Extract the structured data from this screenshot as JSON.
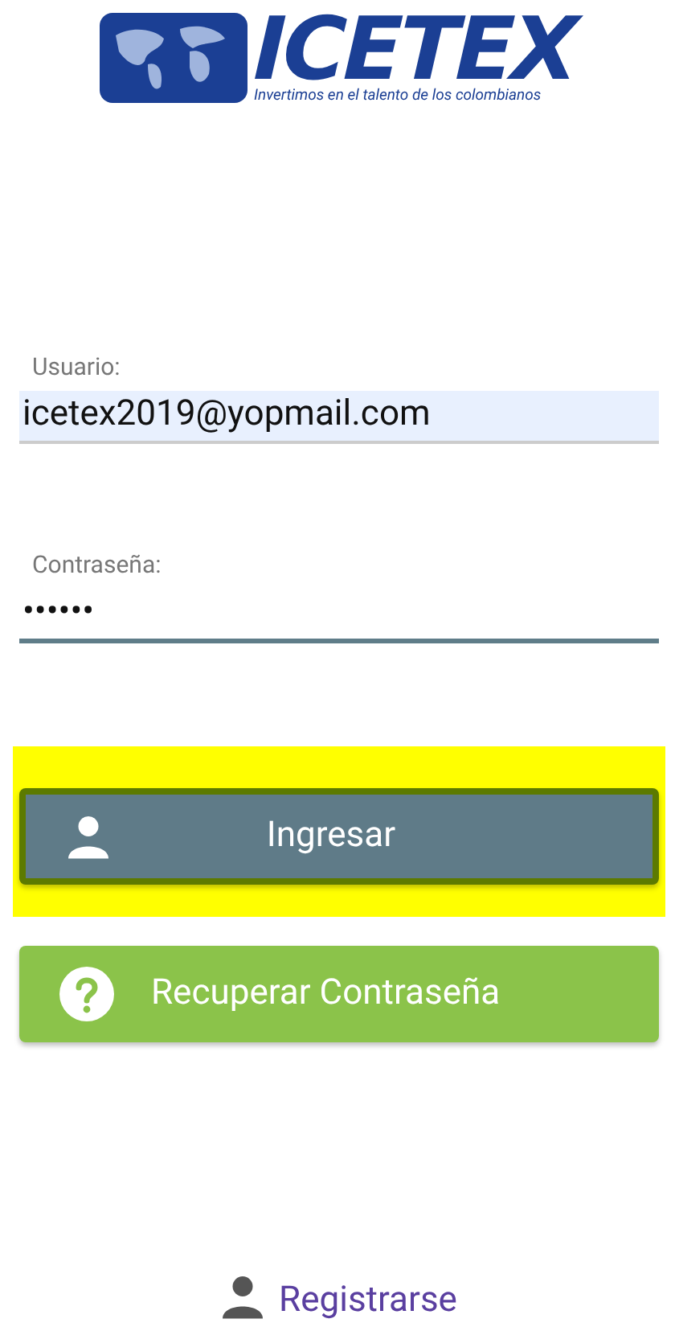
{
  "logo": {
    "name": "ICETEX",
    "tagline": "Invertimos en el talento de los colombianos"
  },
  "fields": [
    {
      "label": "Usuario:",
      "value": "icetex2019@yopmail.com",
      "autofilled": true,
      "focused": false
    },
    {
      "label": "Contraseña:",
      "value": "••••••",
      "autofilled": false,
      "focused": true
    }
  ],
  "buttons": [
    {
      "label": "Ingresar",
      "kind": "primary",
      "highlighted": true
    },
    {
      "label": "Recuperar Contraseña",
      "kind": "help",
      "highlighted": false
    }
  ],
  "register_link": {
    "label": "Registrarse"
  }
}
